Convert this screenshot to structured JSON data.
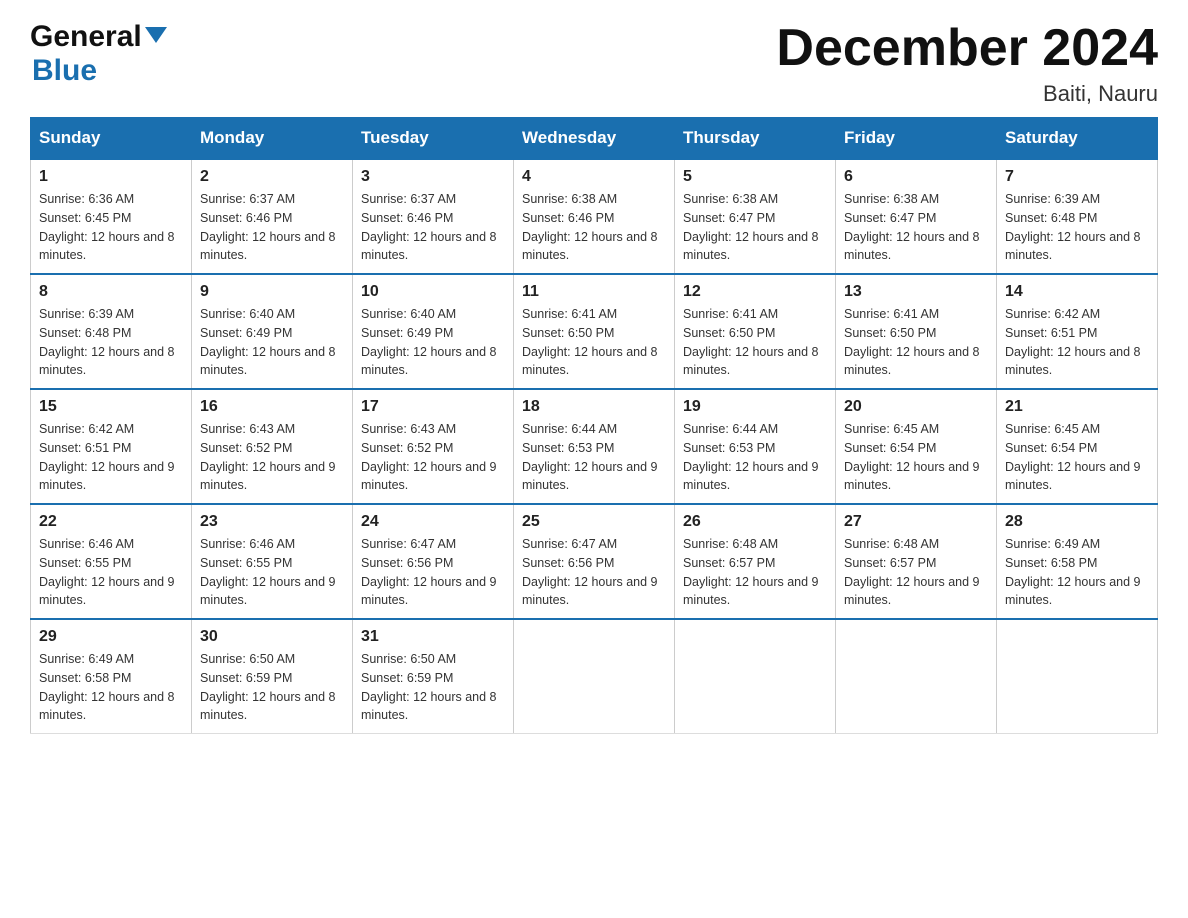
{
  "header": {
    "logo_line1": "General",
    "logo_line2": "Blue",
    "month_title": "December 2024",
    "location": "Baiti, Nauru"
  },
  "days_of_week": [
    "Sunday",
    "Monday",
    "Tuesday",
    "Wednesday",
    "Thursday",
    "Friday",
    "Saturday"
  ],
  "weeks": [
    [
      {
        "date": "1",
        "sunrise": "6:36 AM",
        "sunset": "6:45 PM",
        "daylight": "12 hours and 8 minutes."
      },
      {
        "date": "2",
        "sunrise": "6:37 AM",
        "sunset": "6:46 PM",
        "daylight": "12 hours and 8 minutes."
      },
      {
        "date": "3",
        "sunrise": "6:37 AM",
        "sunset": "6:46 PM",
        "daylight": "12 hours and 8 minutes."
      },
      {
        "date": "4",
        "sunrise": "6:38 AM",
        "sunset": "6:46 PM",
        "daylight": "12 hours and 8 minutes."
      },
      {
        "date": "5",
        "sunrise": "6:38 AM",
        "sunset": "6:47 PM",
        "daylight": "12 hours and 8 minutes."
      },
      {
        "date": "6",
        "sunrise": "6:38 AM",
        "sunset": "6:47 PM",
        "daylight": "12 hours and 8 minutes."
      },
      {
        "date": "7",
        "sunrise": "6:39 AM",
        "sunset": "6:48 PM",
        "daylight": "12 hours and 8 minutes."
      }
    ],
    [
      {
        "date": "8",
        "sunrise": "6:39 AM",
        "sunset": "6:48 PM",
        "daylight": "12 hours and 8 minutes."
      },
      {
        "date": "9",
        "sunrise": "6:40 AM",
        "sunset": "6:49 PM",
        "daylight": "12 hours and 8 minutes."
      },
      {
        "date": "10",
        "sunrise": "6:40 AM",
        "sunset": "6:49 PM",
        "daylight": "12 hours and 8 minutes."
      },
      {
        "date": "11",
        "sunrise": "6:41 AM",
        "sunset": "6:50 PM",
        "daylight": "12 hours and 8 minutes."
      },
      {
        "date": "12",
        "sunrise": "6:41 AM",
        "sunset": "6:50 PM",
        "daylight": "12 hours and 8 minutes."
      },
      {
        "date": "13",
        "sunrise": "6:41 AM",
        "sunset": "6:50 PM",
        "daylight": "12 hours and 8 minutes."
      },
      {
        "date": "14",
        "sunrise": "6:42 AM",
        "sunset": "6:51 PM",
        "daylight": "12 hours and 8 minutes."
      }
    ],
    [
      {
        "date": "15",
        "sunrise": "6:42 AM",
        "sunset": "6:51 PM",
        "daylight": "12 hours and 9 minutes."
      },
      {
        "date": "16",
        "sunrise": "6:43 AM",
        "sunset": "6:52 PM",
        "daylight": "12 hours and 9 minutes."
      },
      {
        "date": "17",
        "sunrise": "6:43 AM",
        "sunset": "6:52 PM",
        "daylight": "12 hours and 9 minutes."
      },
      {
        "date": "18",
        "sunrise": "6:44 AM",
        "sunset": "6:53 PM",
        "daylight": "12 hours and 9 minutes."
      },
      {
        "date": "19",
        "sunrise": "6:44 AM",
        "sunset": "6:53 PM",
        "daylight": "12 hours and 9 minutes."
      },
      {
        "date": "20",
        "sunrise": "6:45 AM",
        "sunset": "6:54 PM",
        "daylight": "12 hours and 9 minutes."
      },
      {
        "date": "21",
        "sunrise": "6:45 AM",
        "sunset": "6:54 PM",
        "daylight": "12 hours and 9 minutes."
      }
    ],
    [
      {
        "date": "22",
        "sunrise": "6:46 AM",
        "sunset": "6:55 PM",
        "daylight": "12 hours and 9 minutes."
      },
      {
        "date": "23",
        "sunrise": "6:46 AM",
        "sunset": "6:55 PM",
        "daylight": "12 hours and 9 minutes."
      },
      {
        "date": "24",
        "sunrise": "6:47 AM",
        "sunset": "6:56 PM",
        "daylight": "12 hours and 9 minutes."
      },
      {
        "date": "25",
        "sunrise": "6:47 AM",
        "sunset": "6:56 PM",
        "daylight": "12 hours and 9 minutes."
      },
      {
        "date": "26",
        "sunrise": "6:48 AM",
        "sunset": "6:57 PM",
        "daylight": "12 hours and 9 minutes."
      },
      {
        "date": "27",
        "sunrise": "6:48 AM",
        "sunset": "6:57 PM",
        "daylight": "12 hours and 9 minutes."
      },
      {
        "date": "28",
        "sunrise": "6:49 AM",
        "sunset": "6:58 PM",
        "daylight": "12 hours and 9 minutes."
      }
    ],
    [
      {
        "date": "29",
        "sunrise": "6:49 AM",
        "sunset": "6:58 PM",
        "daylight": "12 hours and 8 minutes."
      },
      {
        "date": "30",
        "sunrise": "6:50 AM",
        "sunset": "6:59 PM",
        "daylight": "12 hours and 8 minutes."
      },
      {
        "date": "31",
        "sunrise": "6:50 AM",
        "sunset": "6:59 PM",
        "daylight": "12 hours and 8 minutes."
      },
      {
        "date": "",
        "sunrise": "",
        "sunset": "",
        "daylight": ""
      },
      {
        "date": "",
        "sunrise": "",
        "sunset": "",
        "daylight": ""
      },
      {
        "date": "",
        "sunrise": "",
        "sunset": "",
        "daylight": ""
      },
      {
        "date": "",
        "sunrise": "",
        "sunset": "",
        "daylight": ""
      }
    ]
  ],
  "labels": {
    "sunrise_prefix": "Sunrise: ",
    "sunset_prefix": "Sunset: ",
    "daylight_prefix": "Daylight: "
  }
}
